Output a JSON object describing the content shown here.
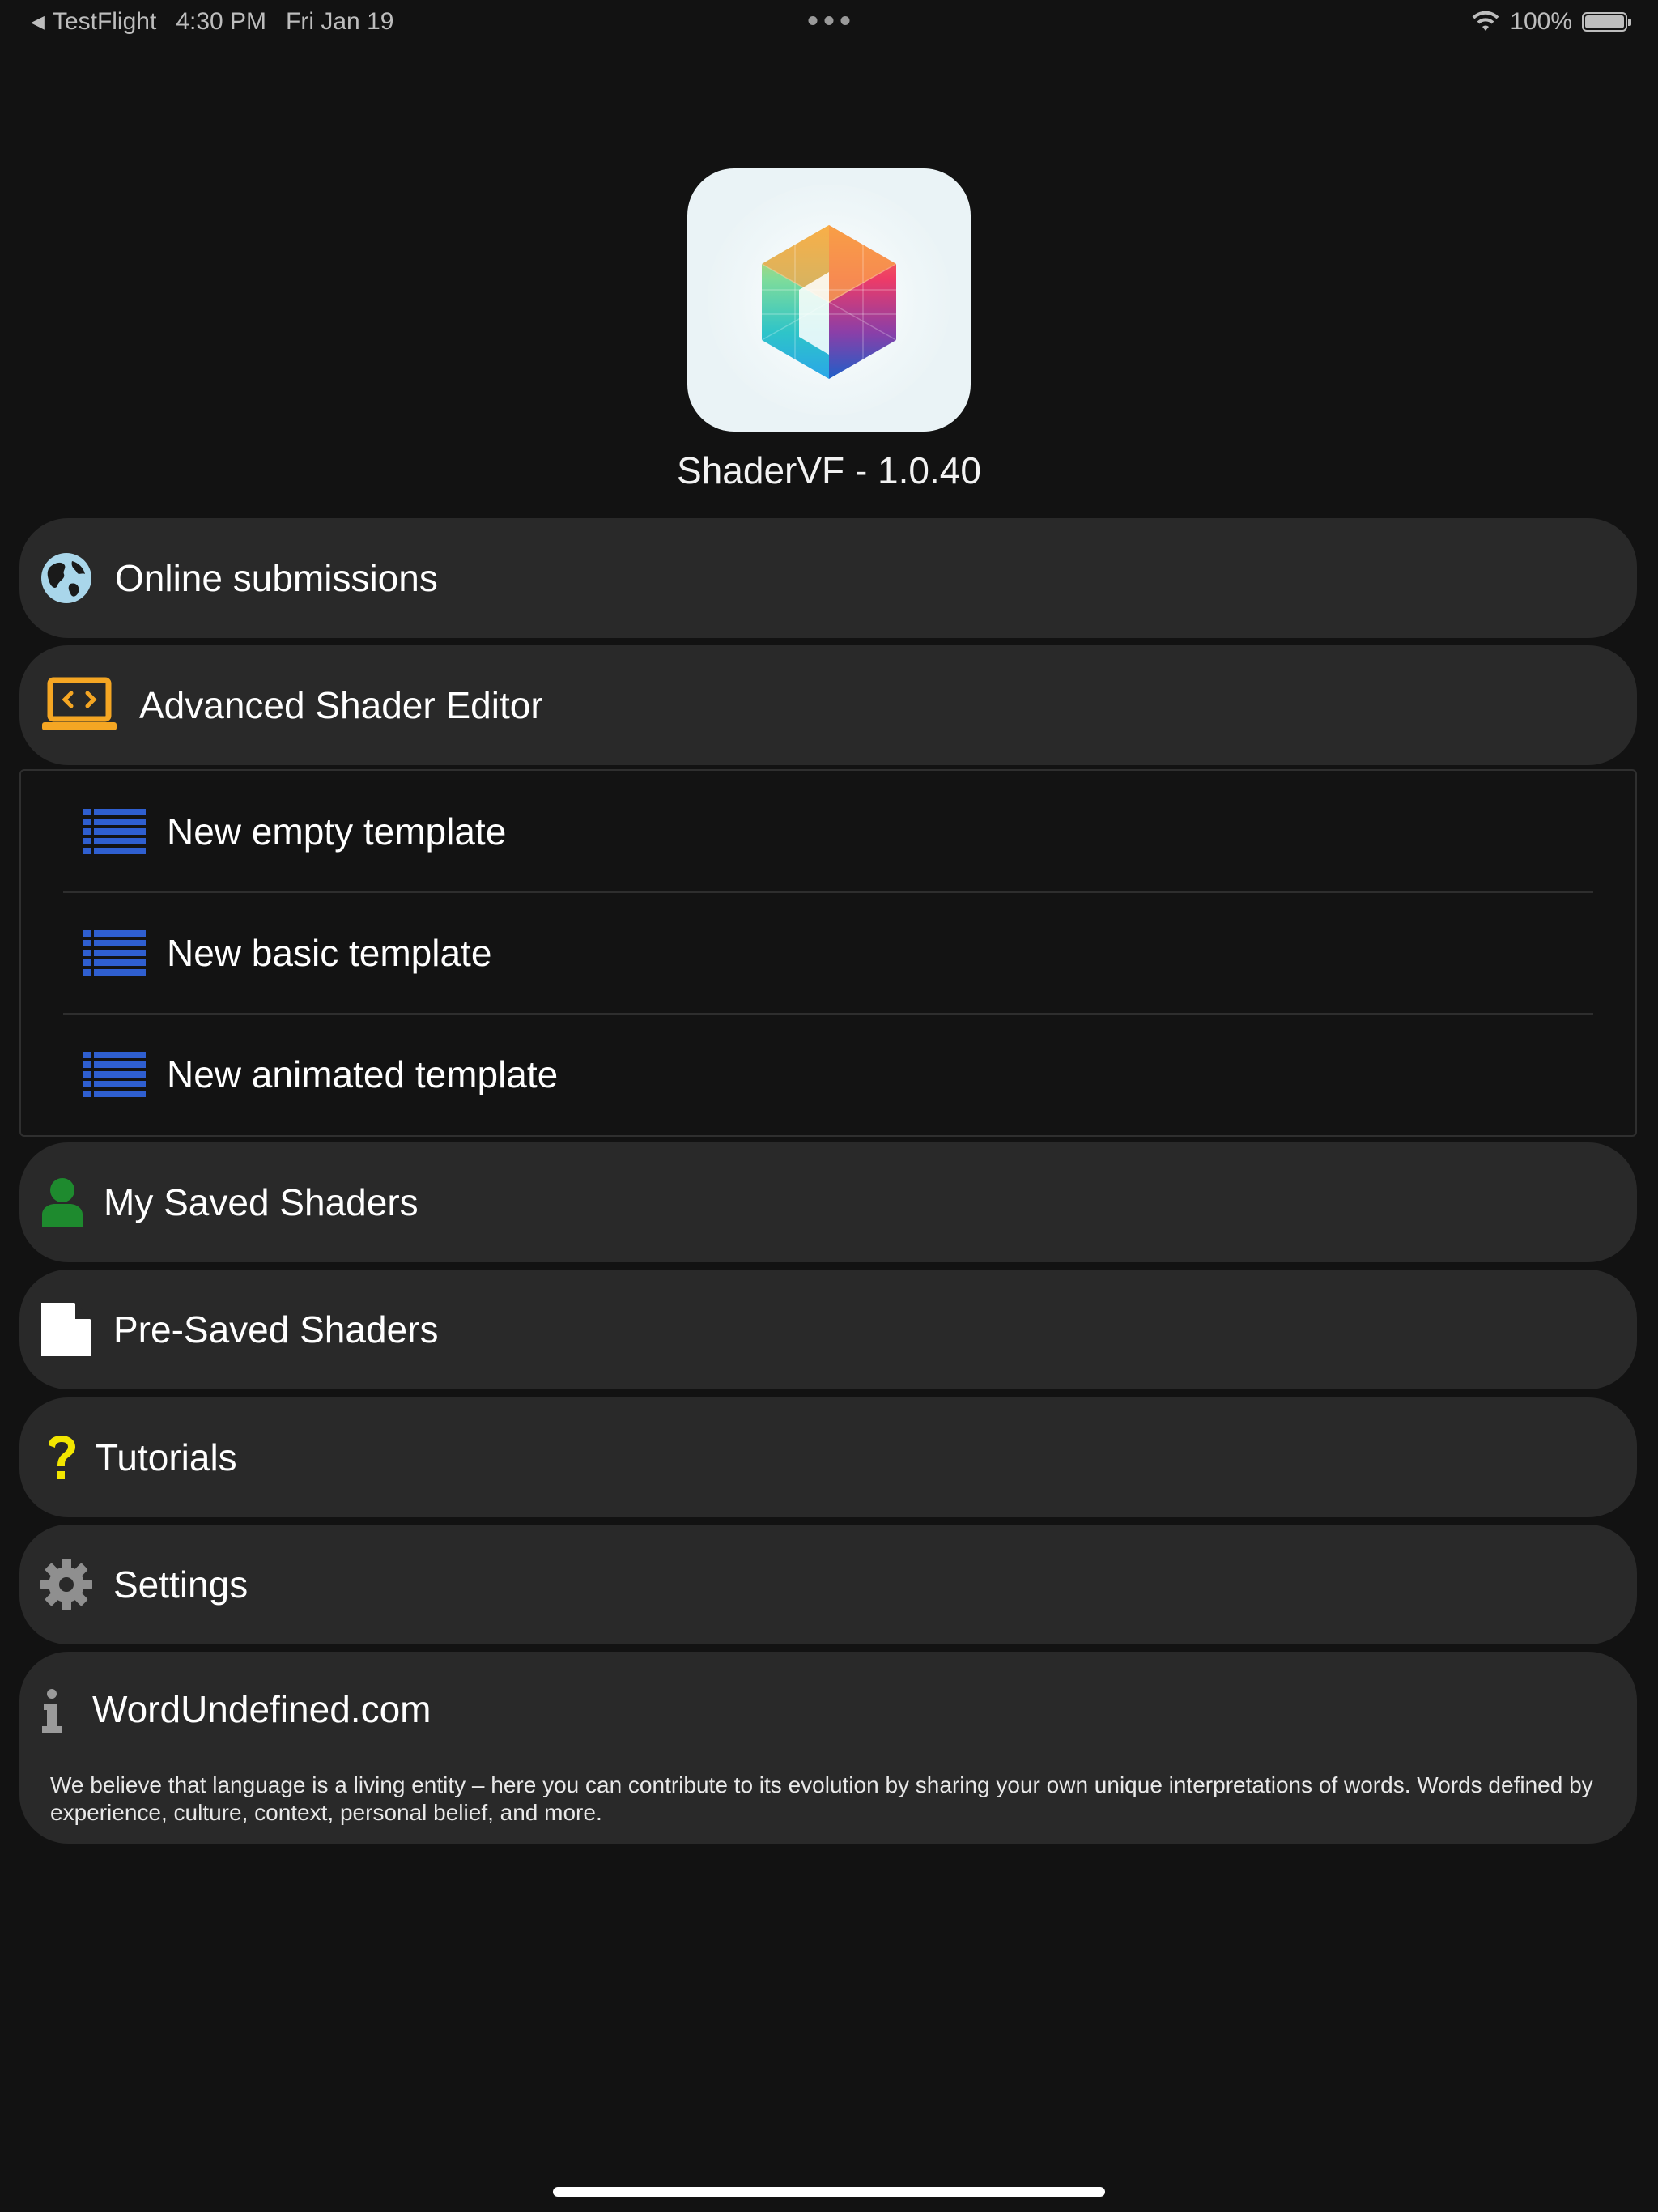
{
  "status_bar": {
    "back_app": "TestFlight",
    "time": "4:30 PM",
    "date": "Fri Jan 19",
    "battery": "100%"
  },
  "app": {
    "title": "ShaderVF - 1.0.40"
  },
  "menu": {
    "online_submissions": "Online submissions",
    "advanced_editor": "Advanced Shader Editor",
    "templates": [
      {
        "label": "New empty template"
      },
      {
        "label": "New basic template"
      },
      {
        "label": "New animated template"
      }
    ],
    "my_saved": "My Saved Shaders",
    "pre_saved": "Pre-Saved Shaders",
    "tutorials": "Tutorials",
    "settings": "Settings"
  },
  "info": {
    "title": "WordUndefined.com",
    "description": "We believe that language is a living entity – here you can contribute to its evolution by sharing your own unique interpretations of words. Words defined by experience, culture, context, personal belief, and more."
  },
  "colors": {
    "background": "#121212",
    "button_bg": "#292929",
    "orange_accent": "#f5a623",
    "blue_list": "#2f5fd0",
    "green_person": "#1e8a2e",
    "yellow_question": "#f2e600",
    "gray_gear": "#8f8f8f"
  },
  "icons": {
    "online_submissions": "globe-icon",
    "advanced_editor": "laptop-code-icon",
    "templates": "list-icon",
    "my_saved": "person-icon",
    "pre_saved": "document-icon",
    "tutorials": "question-icon",
    "settings": "gear-icon",
    "info": "info-icon"
  }
}
